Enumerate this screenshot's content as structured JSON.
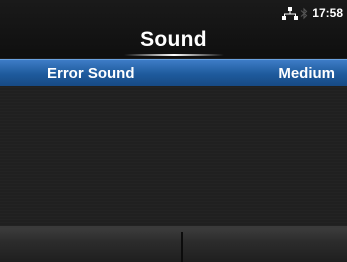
{
  "header": {
    "title": "Sound",
    "status": {
      "time": "17:58",
      "network_icon": "lan-icon",
      "bluetooth_icon": "bluetooth-icon"
    }
  },
  "menu": {
    "items": [
      {
        "label": "Error Sound",
        "value": "Medium",
        "selected": true
      }
    ]
  },
  "softkeys": {
    "left_label": "",
    "right_label": ""
  },
  "colors": {
    "selection": "#1e5a9c",
    "background": "#1c1c1c"
  }
}
